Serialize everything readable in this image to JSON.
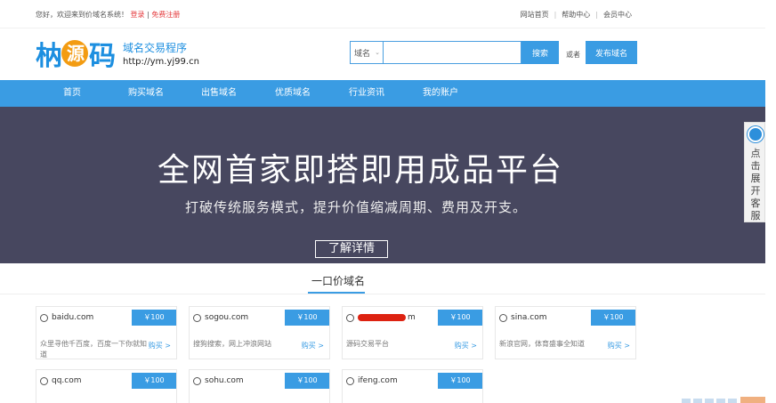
{
  "topbar": {
    "greeting": "您好，欢迎来到价域名系统！",
    "login": "登录",
    "separator": "|",
    "register": "免费注册",
    "links": [
      "网站首页",
      "帮助中心",
      "会员中心"
    ]
  },
  "logo": {
    "mark_left": "枘",
    "mark_circle": "源",
    "mark_right": "码",
    "title": "域名交易程序",
    "url": "http://ym.yj99.cn"
  },
  "search": {
    "select_value": "域名",
    "input_value": "",
    "button": "搜索",
    "or": "或者",
    "publish": "发布域名"
  },
  "nav": [
    "首页",
    "购买域名",
    "出售域名",
    "优质域名",
    "行业资讯",
    "我的账户"
  ],
  "banner": {
    "headline": "全网首家即搭即用成品平台",
    "subline": "打破传统服务模式，提升价值缩减周期、费用及开支。",
    "button": "了解详情"
  },
  "section": {
    "title": "一口价域名"
  },
  "cards": [
    {
      "domain": "baidu.com",
      "price": "￥100",
      "desc": "众里寻他千百度，百度一下你就知道",
      "buy": "购买 >"
    },
    {
      "domain": "sogou.com",
      "price": "￥100",
      "desc": "搜狗搜索，网上冲浪网站",
      "buy": "购买 >"
    },
    {
      "domain": "m",
      "price": "￥100",
      "desc": "源码交易平台",
      "buy": "购买 >"
    },
    {
      "domain": "sina.com",
      "price": "￥100",
      "desc": "新浪官网，体育盛事全知道",
      "buy": "购买 >"
    },
    {
      "domain": "qq.com",
      "price": "￥100",
      "desc": "",
      "buy": ""
    },
    {
      "domain": "sohu.com",
      "price": "￥100",
      "desc": "",
      "buy": ""
    },
    {
      "domain": "ifeng.com",
      "price": "￥100",
      "desc": "",
      "buy": ""
    }
  ],
  "side_service": {
    "label": "点击展开客服"
  },
  "colors": {
    "accent": "#3a9ce3",
    "banner": "#47475f",
    "link_red": "#e4393c"
  }
}
